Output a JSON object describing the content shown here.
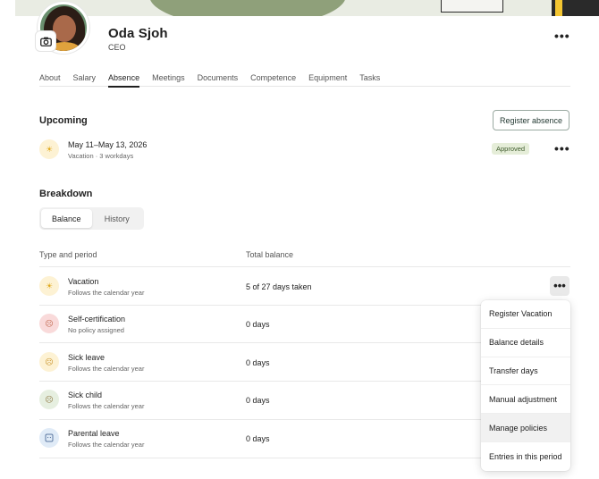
{
  "profile": {
    "name": "Oda Sjoh",
    "role": "CEO"
  },
  "icons": {
    "camera": "camera-icon",
    "more": "more-horizontal-icon",
    "vacation": "sun-icon",
    "self_cert": "sick-face-icon",
    "sick_leave": "thermometer-face-icon",
    "sick_child": "crying-face-icon",
    "parental": "baby-icon"
  },
  "tabs": [
    {
      "label": "About"
    },
    {
      "label": "Salary"
    },
    {
      "label": "Absence"
    },
    {
      "label": "Meetings"
    },
    {
      "label": "Documents"
    },
    {
      "label": "Competence"
    },
    {
      "label": "Equipment"
    },
    {
      "label": "Tasks"
    }
  ],
  "active_tab": "Absence",
  "upcoming": {
    "title": "Upcoming",
    "register_button": "Register absence",
    "item": {
      "dates": "May 11–May 13, 2026",
      "detail": "Vacation · 3 workdays",
      "status": "Approved"
    }
  },
  "breakdown": {
    "title": "Breakdown",
    "toggle": {
      "balance": "Balance",
      "history": "History",
      "selected": "Balance"
    },
    "columns": {
      "type": "Type and period",
      "total": "Total balance"
    },
    "rows": [
      {
        "name": "Vacation",
        "period": "Follows the calendar year",
        "balance": "5 of 27 days taken"
      },
      {
        "name": "Self-certification",
        "period": "No policy assigned",
        "balance": "0 days"
      },
      {
        "name": "Sick leave",
        "period": "Follows the calendar year",
        "balance": "0 days"
      },
      {
        "name": "Sick child",
        "period": "Follows the calendar year",
        "balance": "0 days"
      },
      {
        "name": "Parental leave",
        "period": "Follows the calendar year",
        "balance": "0 days"
      }
    ]
  },
  "row_menu": {
    "items": [
      "Register Vacation",
      "Balance details",
      "Transfer days",
      "Manual adjustment",
      "Manage policies",
      "Entries in this period"
    ],
    "hovered": "Manage policies"
  },
  "colors": {
    "approved_bg": "#e5edd8",
    "approved_text": "#3d5a2b",
    "primary_outline": "#9aa9a1"
  }
}
